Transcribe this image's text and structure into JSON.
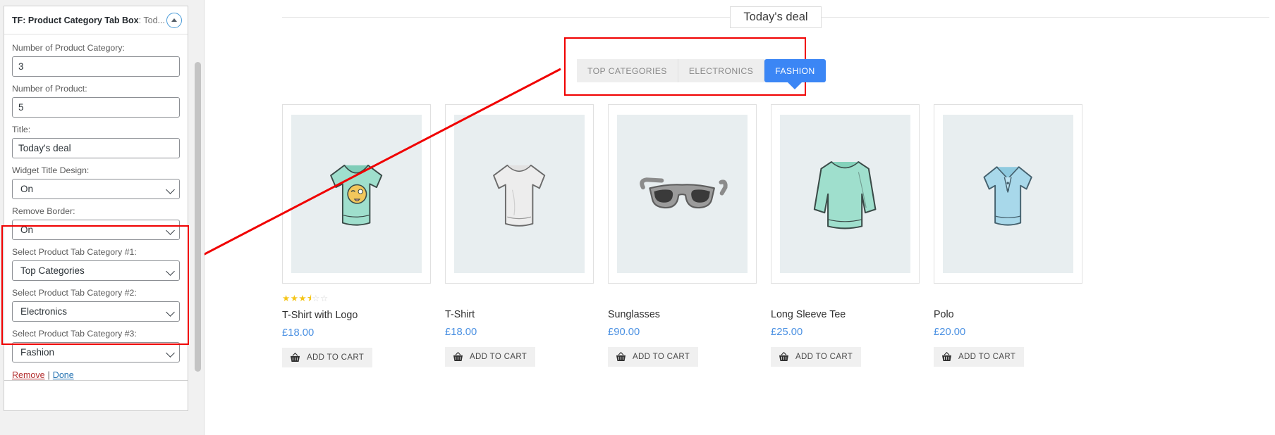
{
  "sidebar": {
    "widget": {
      "title_prefix": "TF: Product Category Tab Box",
      "title_suffix": ": Tod...",
      "toggle_icon": "caret-up-icon",
      "fields": [
        {
          "label": "Number of Product Category:",
          "value": "3",
          "type": "text"
        },
        {
          "label": "Number of Product:",
          "value": "5",
          "type": "text"
        },
        {
          "label": "Title:",
          "value": "Today's deal",
          "type": "text"
        },
        {
          "label": "Widget Title Design:",
          "value": "On",
          "type": "select"
        },
        {
          "label": "Remove Border:",
          "value": "On",
          "type": "select"
        },
        {
          "label": "Select Product Tab Category #1:",
          "value": "Top Categories",
          "type": "select"
        },
        {
          "label": "Select Product Tab Category #2:",
          "value": "Electronics",
          "type": "select"
        },
        {
          "label": "Select Product Tab Category #3:",
          "value": "Fashion",
          "type": "select"
        }
      ],
      "actions": {
        "remove_label": "Remove",
        "separator": "|",
        "done_label": "Done"
      }
    }
  },
  "main": {
    "deal_title": "Today's deal",
    "tabs": [
      {
        "label": "TOP CATEGORIES",
        "active": false
      },
      {
        "label": "ELECTRONICS",
        "active": false
      },
      {
        "label": "FASHION",
        "active": true
      }
    ],
    "add_to_cart_label": "ADD TO CART",
    "cart_icon": "basket-icon",
    "products": [
      {
        "name": "T-Shirt with Logo",
        "price": "£18.00",
        "rating": 3.5,
        "image": "tshirt-logo-icon"
      },
      {
        "name": "T-Shirt",
        "price": "£18.00",
        "rating": 0,
        "image": "tshirt-icon"
      },
      {
        "name": "Sunglasses",
        "price": "£90.00",
        "rating": 0,
        "image": "sunglasses-icon"
      },
      {
        "name": "Long Sleeve Tee",
        "price": "£25.00",
        "rating": 0,
        "image": "long-sleeve-tee-icon"
      },
      {
        "name": "Polo",
        "price": "£20.00",
        "rating": 0,
        "image": "polo-icon"
      }
    ]
  },
  "colors": {
    "accent_blue": "#3b86f5",
    "price_blue": "#4a90e2",
    "highlight_red": "#f00000",
    "star_gold": "#f5c518",
    "thumb_bg": "#e8eef0"
  }
}
